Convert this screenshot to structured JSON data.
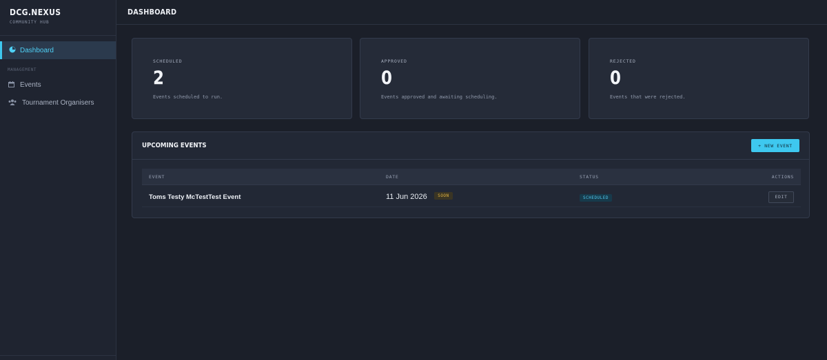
{
  "brand": {
    "title": "DCG.NEXUS",
    "subtitle": "COMMUNITY HUB"
  },
  "sidebar": {
    "active_item": {
      "label": "Dashboard",
      "icon": "dashboard-icon"
    },
    "section_label": "MANAGEMENT",
    "items": [
      {
        "label": "Events",
        "icon": "calendar-icon"
      },
      {
        "label": "Tournament Organisers",
        "icon": "users-icon"
      }
    ]
  },
  "header": {
    "title": "DASHBOARD"
  },
  "stats": [
    {
      "label": "SCHEDULED",
      "value": "2",
      "description": "Events scheduled to run."
    },
    {
      "label": "APPROVED",
      "value": "0",
      "description": "Events approved and awaiting scheduling."
    },
    {
      "label": "REJECTED",
      "value": "0",
      "description": "Events that were rejected."
    }
  ],
  "upcoming": {
    "title": "UPCOMING EVENTS",
    "new_button": "+ NEW EVENT",
    "columns": [
      "EVENT",
      "DATE",
      "STATUS",
      "ACTIONS"
    ],
    "rows": [
      {
        "event": "Toms Testy McTestTest Event",
        "date": "11 Jun 2026",
        "badge": "SOON",
        "status": "SCHEDULED",
        "action": "EDIT"
      }
    ]
  },
  "colors": {
    "accent": "#3ec8ef",
    "background": "#1b1f29",
    "card": "#252b38",
    "soon": "#e0b341"
  }
}
